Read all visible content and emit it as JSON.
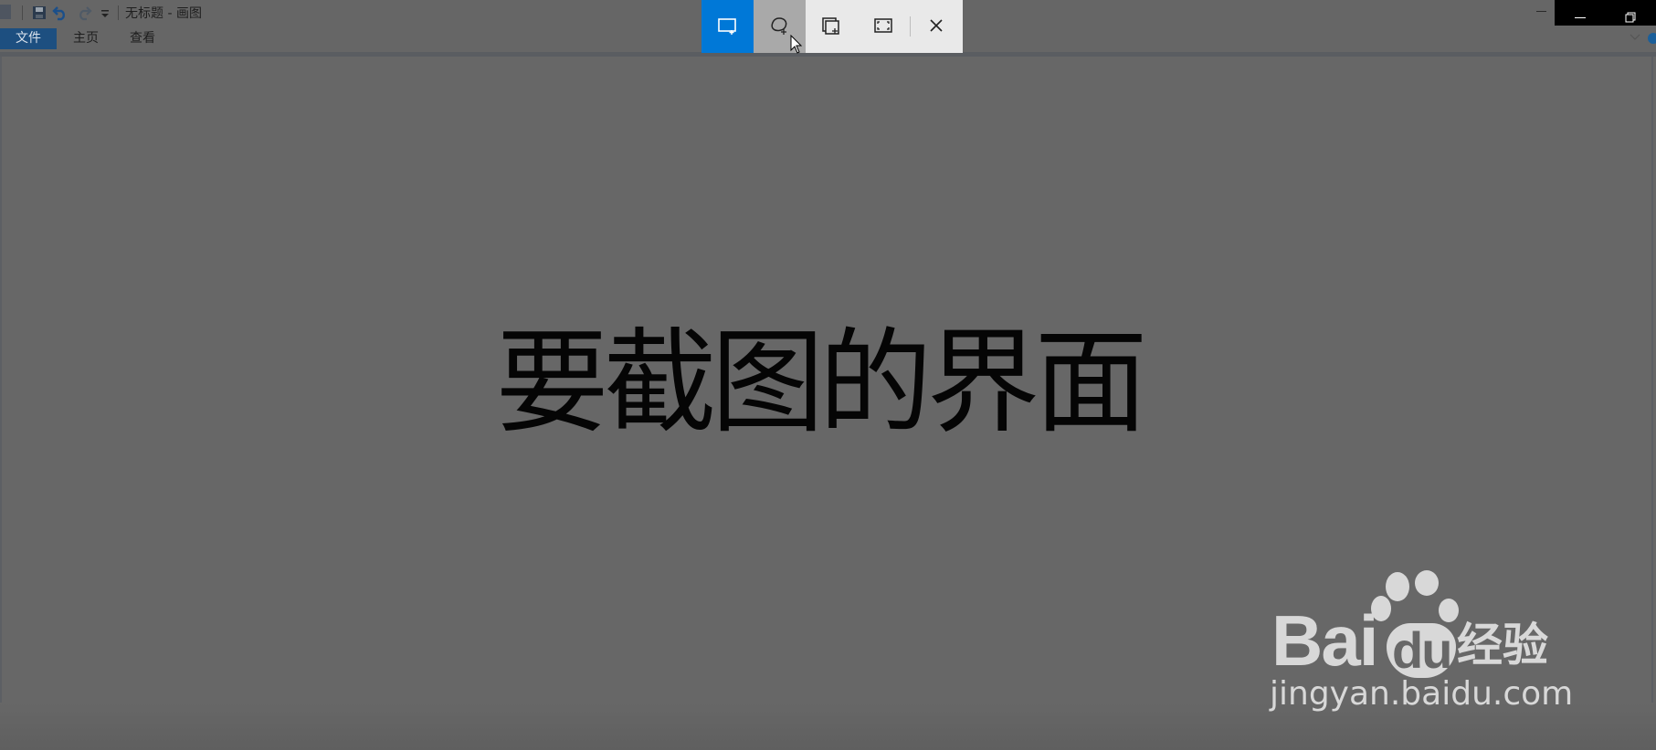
{
  "window": {
    "title": "无标题 - 画图",
    "minimize_icon": "minimize-icon",
    "restore_icon": "restore-icon"
  },
  "quick_access": {
    "icons": [
      "app-icon",
      "save-icon",
      "undo-icon",
      "redo-icon",
      "customize-dropdown-icon"
    ]
  },
  "ribbon": {
    "tabs": [
      {
        "label": "文件",
        "active": true
      },
      {
        "label": "主页"
      },
      {
        "label": "查看"
      }
    ]
  },
  "snip_toolbar": {
    "buttons": [
      {
        "icon": "rectangular-snip-icon",
        "selected": true
      },
      {
        "icon": "freeform-snip-icon",
        "hovered": true
      },
      {
        "icon": "window-snip-icon"
      },
      {
        "icon": "fullscreen-snip-icon"
      },
      {
        "icon": "close-icon"
      }
    ],
    "accent": "#0078d7"
  },
  "canvas": {
    "text": "要截图的界面"
  },
  "watermark": {
    "logo": "Bai",
    "logo_du": "du",
    "jingyan": "经验",
    "url": "jingyan.baidu.com"
  }
}
